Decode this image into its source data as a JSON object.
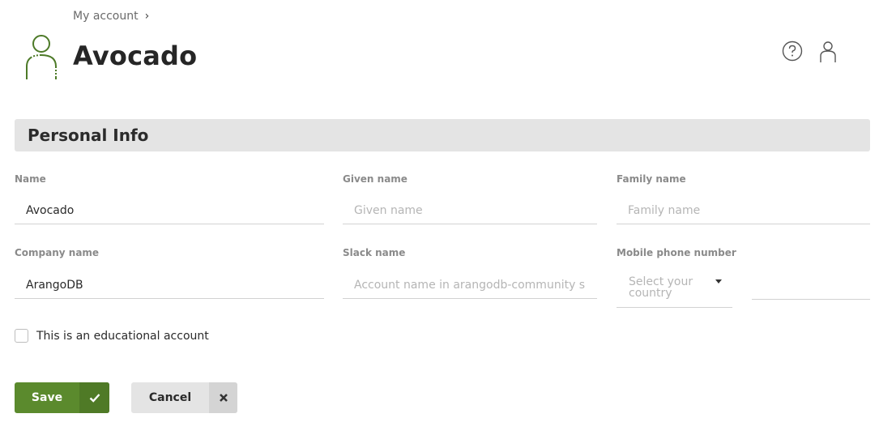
{
  "breadcrumb": {
    "label": "My account",
    "chevron": "›"
  },
  "header": {
    "title": "Avocado",
    "avatar_icon": "user-avatar-icon",
    "help_icon": "help-circle-icon",
    "profile_icon": "user-icon"
  },
  "section": {
    "title": "Personal Info"
  },
  "fields": {
    "name": {
      "label": "Name",
      "value": "Avocado",
      "placeholder": ""
    },
    "given_name": {
      "label": "Given name",
      "value": "",
      "placeholder": "Given name"
    },
    "family_name": {
      "label": "Family name",
      "value": "",
      "placeholder": "Family name"
    },
    "company_name": {
      "label": "Company name",
      "value": "ArangoDB",
      "placeholder": ""
    },
    "slack_name": {
      "label": "Slack name",
      "value": "",
      "placeholder": "Account name in arangodb-community slack"
    },
    "mobile_phone": {
      "label": "Mobile phone number",
      "country_placeholder": "Select your country",
      "value": ""
    }
  },
  "educational": {
    "label": "This is an educational account",
    "checked": false
  },
  "actions": {
    "save_label": "Save",
    "cancel_label": "Cancel",
    "save_icon": "check-icon",
    "cancel_icon": "close-icon"
  },
  "colors": {
    "accent": "#5b8a2d",
    "section_bg": "#e4e4e4"
  }
}
